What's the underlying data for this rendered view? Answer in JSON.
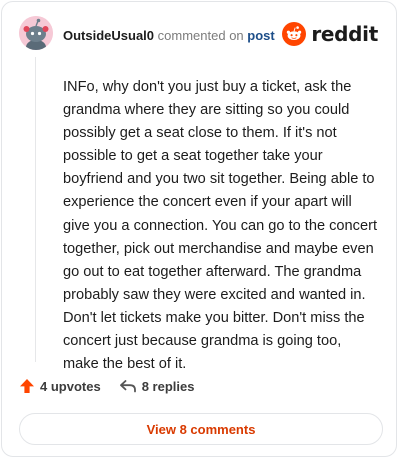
{
  "comment": {
    "author": "OutsideUsual0",
    "action_text": "commented on",
    "link_text": "post",
    "body": "INFo, why don't you just buy a ticket, ask the grandma where they are sitting so you could possibly get a seat close to them. If it's not possible to get a seat together take your boyfriend and you two sit together. Being able to experience the concert even if your apart will give you a connection. You can go to the concert together, pick out merchandise and maybe even go out to eat together afterward. The grandma probably saw they were excited and wanted in. Don't let tickets make you bitter. Don't miss the concert just because grandma is going too, make the best of it."
  },
  "brand": {
    "name": "reddit",
    "icon": "reddit-logo-icon",
    "color": "#ff4500"
  },
  "actions": {
    "upvotes": "4 upvotes",
    "replies": "8 replies",
    "upvote_icon": "upvote-arrow-icon",
    "reply_icon": "reply-arrow-icon"
  },
  "view_button": {
    "label": "View 8 comments",
    "color": "#d93a00"
  },
  "avatar": {
    "icon": "snoo-avatar-icon",
    "bg": "#f6c9d6"
  }
}
